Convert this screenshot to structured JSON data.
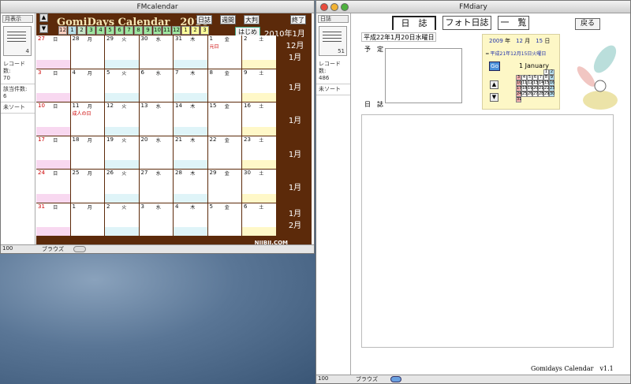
{
  "left_window": {
    "title": "FMcalendar",
    "panel": {
      "view_button": "月表示",
      "records_label": "レコード数:",
      "records_value": "70",
      "found_label": "該当件数:",
      "found_value": "6",
      "sort": "未ソート",
      "book_num": "4"
    },
    "header": {
      "title": "GomiDays Calendar",
      "year": "2010",
      "btn_diary": "日誌",
      "btn_weekly": "週間",
      "btn_large": "大判",
      "btn_exit": "終了",
      "btn_start": "はじめに",
      "current": "2010年1月"
    },
    "months": [
      "12",
      "1",
      "2",
      "3",
      "4",
      "5",
      "6",
      "7",
      "8",
      "9",
      "10",
      "11",
      "12",
      "1",
      "2",
      "3"
    ],
    "weeks": [
      {
        "days": [
          "27",
          "28",
          "29",
          "30",
          "31",
          "1",
          "2"
        ],
        "label": "12月\n1月"
      },
      {
        "days": [
          "3",
          "4",
          "5",
          "6",
          "7",
          "8",
          "9"
        ],
        "label": "1月"
      },
      {
        "days": [
          "10",
          "11",
          "12",
          "13",
          "14",
          "15",
          "16"
        ],
        "label": "1月"
      },
      {
        "days": [
          "17",
          "18",
          "19",
          "20",
          "21",
          "22",
          "23"
        ],
        "label": "1月"
      },
      {
        "days": [
          "24",
          "25",
          "26",
          "27",
          "28",
          "29",
          "30"
        ],
        "label": "1月"
      },
      {
        "days": [
          "31",
          "1",
          "2",
          "3",
          "4",
          "5",
          "6"
        ],
        "label": "1月\n2月"
      }
    ],
    "weekdays": [
      "日",
      "月",
      "火",
      "水",
      "木",
      "金",
      "土"
    ],
    "holidays": [
      {
        "week": 0,
        "day": 5,
        "text": "元日"
      },
      {
        "week": 2,
        "day": 1,
        "text": "成人の日"
      }
    ],
    "brand": "NIIBII.COM",
    "status": {
      "zoom": "100",
      "mode": "ブラウズ"
    }
  },
  "right_window": {
    "title": "FMdiary",
    "panel": {
      "view_button": "日誌",
      "records_label": "レコード数:",
      "records_value": "486",
      "sort": "未ソート",
      "book_num": "51"
    },
    "tabs": [
      "日　誌",
      "フォト日誌",
      "一　覧"
    ],
    "back": "戻る",
    "date_label": "平成22年1月20日水曜日",
    "plan_label": "予　定",
    "diary_label": "日　誌",
    "mini": {
      "year": "2009",
      "year_unit": "年",
      "month": "12",
      "month_unit": "月",
      "day": "15",
      "day_unit": "日",
      "wareki": "平成21年12月15日火曜日",
      "go": "Go",
      "month_name": "1 January",
      "cells": [
        "",
        "",
        "",
        "",
        "",
        "1",
        "2",
        "3",
        "4",
        "5",
        "6",
        "7",
        "8",
        "9",
        "10",
        "11",
        "12",
        "13",
        "14",
        "15",
        "16",
        "17",
        "18",
        "19",
        "20",
        "21",
        "22",
        "23",
        "24",
        "25",
        "26",
        "27",
        "28",
        "29",
        "30",
        "31"
      ]
    },
    "footer": "Gomidays Calendar　v1.1",
    "status": {
      "zoom": "100",
      "mode": "ブラウズ"
    }
  }
}
